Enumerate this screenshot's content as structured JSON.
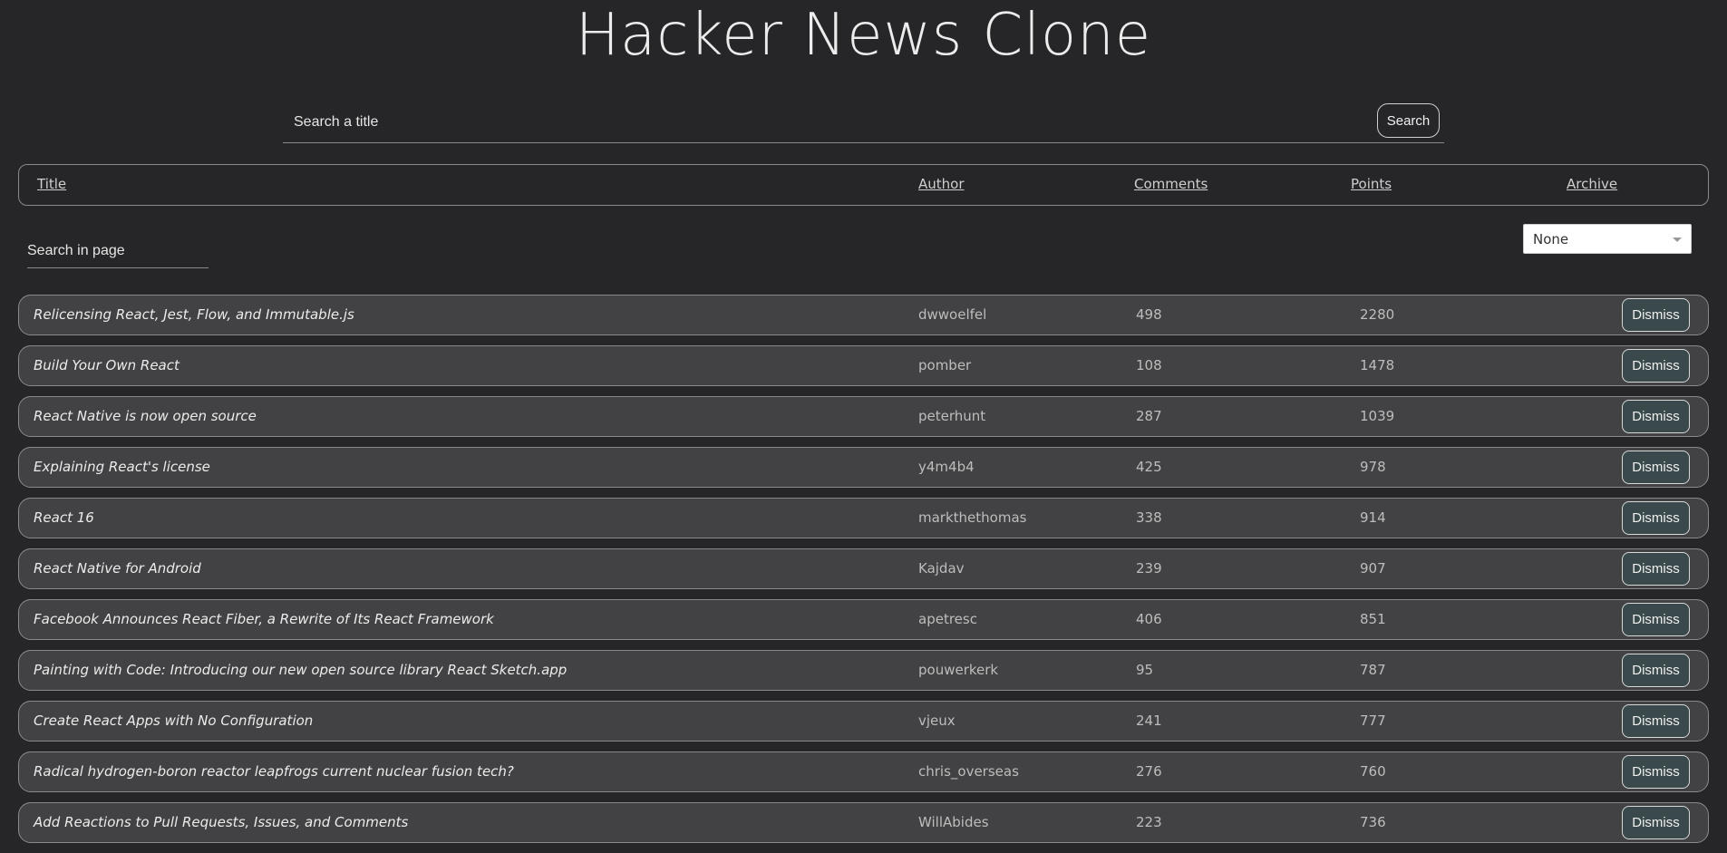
{
  "app": {
    "title": "Hacker News Clone"
  },
  "search": {
    "placeholder": "Search a title",
    "button_label": "Search"
  },
  "table": {
    "headers": {
      "title": "Title",
      "author": "Author",
      "comments": "Comments",
      "points": "Points",
      "archive": "Archive"
    },
    "page_search_placeholder": "Search in page",
    "sort_select": {
      "value": "None"
    },
    "dismiss_label": "Dismiss",
    "rows": [
      {
        "title": "Relicensing React, Jest, Flow, and Immutable.js",
        "author": "dwwoelfel",
        "comments": "498",
        "points": "2280"
      },
      {
        "title": "Build Your Own React",
        "author": "pomber",
        "comments": "108",
        "points": "1478"
      },
      {
        "title": "React Native is now open source",
        "author": "peterhunt",
        "comments": "287",
        "points": "1039"
      },
      {
        "title": "Explaining React's license",
        "author": "y4m4b4",
        "comments": "425",
        "points": "978"
      },
      {
        "title": "React 16",
        "author": "markthethomas",
        "comments": "338",
        "points": "914"
      },
      {
        "title": "React Native for Android",
        "author": "Kajdav",
        "comments": "239",
        "points": "907"
      },
      {
        "title": "Facebook Announces React Fiber, a Rewrite of Its React Framework",
        "author": "apetresc",
        "comments": "406",
        "points": "851"
      },
      {
        "title": "Painting with Code: Introducing our new open source library React Sketch.app",
        "author": "pouwerkerk",
        "comments": "95",
        "points": "787"
      },
      {
        "title": "Create React Apps with No Configuration",
        "author": "vjeux",
        "comments": "241",
        "points": "777"
      },
      {
        "title": "Radical hydrogen-boron reactor leapfrogs current nuclear fusion tech?",
        "author": "chris_overseas",
        "comments": "276",
        "points": "760"
      },
      {
        "title": "Add Reactions to Pull Requests, Issues, and Comments",
        "author": "WillAbides",
        "comments": "223",
        "points": "736"
      }
    ]
  }
}
